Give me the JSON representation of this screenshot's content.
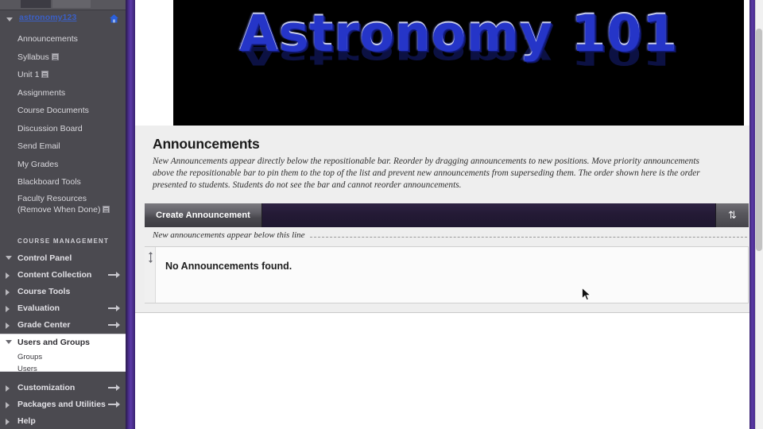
{
  "sidebar": {
    "course": {
      "title": "astronomy123",
      "home_icon": "home-icon",
      "caret_icon": "caret-down-icon"
    },
    "nav_items": [
      {
        "label": "Announcements",
        "icon": null
      },
      {
        "label": "Syllabus",
        "icon": "page-icon"
      },
      {
        "label": "Unit 1",
        "icon": "page-icon"
      },
      {
        "label": "Assignments",
        "icon": null
      },
      {
        "label": "Course Documents",
        "icon": null
      },
      {
        "label": "Discussion Board",
        "icon": null
      },
      {
        "label": "Send Email",
        "icon": null
      },
      {
        "label": "My Grades",
        "icon": null
      },
      {
        "label": "Blackboard Tools",
        "icon": null
      },
      {
        "label": "Faculty Resources",
        "label2": "(Remove When Done)",
        "icon": "page-icon"
      }
    ],
    "course_management_header": "COURSE MANAGEMENT",
    "cm_items": [
      {
        "label": "Control Panel",
        "caret": "caret-down-icon",
        "arrow": false
      },
      {
        "label": "Content Collection",
        "caret": "caret-right-icon",
        "arrow": true
      },
      {
        "label": "Course Tools",
        "caret": "caret-right-icon",
        "arrow": false
      },
      {
        "label": "Evaluation",
        "caret": "caret-right-icon",
        "arrow": true
      },
      {
        "label": "Grade Center",
        "caret": "caret-right-icon",
        "arrow": true
      }
    ],
    "cm_open_group": {
      "label": "Users and Groups",
      "caret": "caret-down-icon",
      "sub_items": [
        {
          "label": "Groups"
        },
        {
          "label": "Users"
        }
      ]
    },
    "cm_items_lower": [
      {
        "label": "Customization",
        "caret": "caret-right-icon",
        "arrow": true
      },
      {
        "label": "Packages and Utilities",
        "caret": "caret-right-icon",
        "arrow": true
      },
      {
        "label": "Help",
        "caret": "caret-right-icon",
        "arrow": false
      }
    ]
  },
  "banner": {
    "text": "Astronomy 101",
    "reflection_text": "Astronomy 101",
    "background_color": "#000000",
    "text_color": "#2535c8"
  },
  "main": {
    "page_title": "Announcements",
    "description": "New Announcements appear directly below the repositionable bar. Reorder by dragging announcements to new positions. Move priority announcements above the repositionable bar to pin them to the top of the list and prevent new announcements from superseding them. The order shown here is the order presented to students. Students do not see the bar and cannot reorder announcements.",
    "toolbar": {
      "create_label": "Create Announcement",
      "sort_icon": "sort-updown-icon",
      "sort_glyph": "⇅",
      "bar_color": "#241a35"
    },
    "repositionable_bar": {
      "label": "New announcements appear below this line"
    },
    "list": {
      "drag_handle_icon": "drag-handle-icon",
      "empty_message": "No Announcements found."
    }
  },
  "chrome": {
    "divider_color": "#4b2f8f",
    "right_edge_color": "#5a39a6",
    "cursor_icon": "mouse-pointer-icon",
    "scrollbar_icon": "vertical-scrollbar"
  }
}
